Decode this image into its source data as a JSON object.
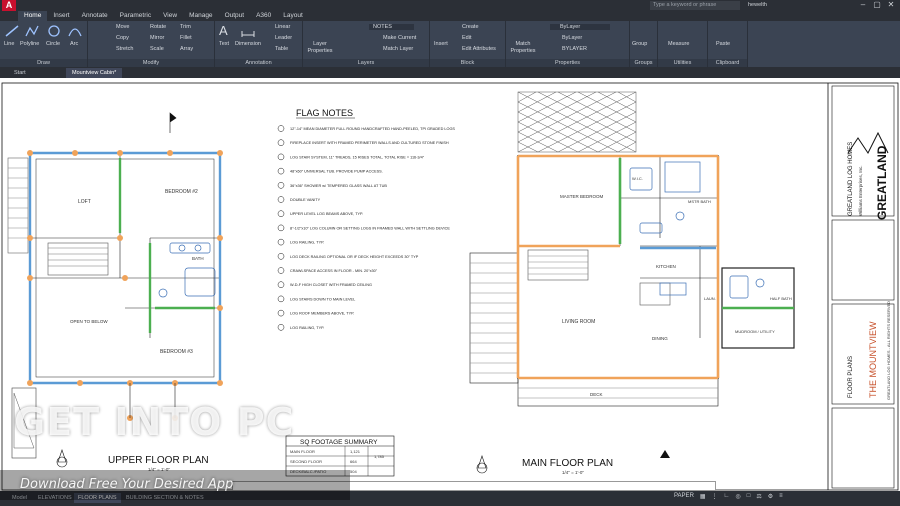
{
  "app": {
    "search_placeholder": "Type a keyword or phrase",
    "user": "hewelth"
  },
  "menu": [
    "Home",
    "Insert",
    "Annotate",
    "Parametric",
    "View",
    "Manage",
    "Output",
    "A360",
    "Layout"
  ],
  "menu_active": "Home",
  "ribbon": {
    "draw": {
      "title": "Draw",
      "tools": [
        "Line",
        "Polyline",
        "Circle",
        "Arc"
      ]
    },
    "modify": {
      "title": "Modify",
      "tools": [
        "Move",
        "Rotate",
        "Trim",
        "Copy",
        "Mirror",
        "Fillet",
        "Stretch",
        "Scale",
        "Array"
      ]
    },
    "annotation": {
      "title": "Annotation",
      "tools": [
        "Text",
        "Dimension",
        "Linear",
        "Leader",
        "Table"
      ]
    },
    "layers": {
      "title": "Layers",
      "tools": [
        "Layer Properties",
        "NOTES",
        "Make Current",
        "Match Layer"
      ]
    },
    "block": {
      "title": "Block",
      "tools": [
        "Insert",
        "Create",
        "Edit",
        "Edit Attributes"
      ]
    },
    "properties": {
      "title": "Properties",
      "tools": [
        "Match Properties",
        "ByLayer",
        "ByLayer",
        "BYLAYER"
      ]
    },
    "groups": {
      "title": "Groups",
      "tools": [
        "Group"
      ]
    },
    "utilities": {
      "title": "Utilities",
      "tools": [
        "Measure"
      ]
    },
    "clipboard": {
      "title": "Clipboard",
      "tools": [
        "Paste"
      ]
    }
  },
  "doc_tabs": [
    "Start",
    "Mountview Cabin*"
  ],
  "drawing": {
    "flag_notes_title": "FLAG NOTES",
    "flag_notes": [
      "12\"-14\" MEAN DIAMETER FULL ROUND HANDCRAFTED HAND-PEELED, TPI GRADED LOGS",
      "FIREPLACE INSERT WITH FRAMED PERIMETER WALLS AND CULTURED STONE FINISH",
      "LOG STAIR SYSTEM, 11\" TREADS, 15 RISES TOTAL, TOTAL RISE = 116-3/4\"",
      "48\"x60\" UNIVERSAL TUB. PROVIDE PUMP ACCESS.",
      "36\"x36\" SHOWER w/ TEMPERED GLASS WALL AT TUB",
      "DOUBLE VANITY",
      "UPPER LEVEL LOG BEAMS ABOVE, TYP.",
      "8\"-1/2\"x10\" LOG COLUMN OR SETTING LOGS IN FRAMED WALL WITH SETTLING DEVICE",
      "LOG RAILING, TYP.",
      "LOG DECK RAILING OPTIONAL OR IF DECK HEIGHT EXCEEDS 30\" TYP",
      "CRAWLSPACE ACCESS IN FLOOR - MIN. 20\"x30\"",
      "W-D-F HIGH CLOSET WITH FRAMED CEILING",
      "LOG STAIRS DOWN TO MAIN LEVEL",
      "LOG ROOF MEMBERS ABOVE, TYP.",
      "LOG RAILING, TYP."
    ],
    "upper_plan_title": "UPPER FLOOR PLAN",
    "upper_plan_scale": "1/4\" = 1'-0\"",
    "main_plan_title": "MAIN FLOOR PLAN",
    "main_plan_scale": "1/4\" = 1'-0\"",
    "upper_rooms": [
      "LOFT",
      "BEDROOM #2",
      "BATH",
      "OPEN TO BELOW",
      "BEDROOM #3"
    ],
    "main_rooms": [
      "MASTER BEDROOM",
      "W.I.C.",
      "MSTR BATH",
      "KITCHEN",
      "LIVING ROOM",
      "DINING",
      "LAUN.",
      "HALF BATH",
      "MUDROOM / UTILITY",
      "DECK"
    ],
    "sq_footage": {
      "title": "SQ FOOTAGE SUMMARY",
      "rows": [
        [
          "MAIN FLOOR",
          "1,121"
        ],
        [
          "SECOND FLOOR",
          "664"
        ],
        [
          "DECK/BALC./PATIO",
          "504"
        ]
      ],
      "total": "1,785"
    },
    "title_block": {
      "company": "GREATLAND LOG HOMES",
      "company_sub": "Williams Enterprises, Inc.",
      "project": "THE MOUNTVIEW",
      "sheet": "FLOOR PLANS",
      "rights": "GREATLAND LOG HOMES - ALL RIGHTS RESERVED",
      "logo": "GREATLAND"
    }
  },
  "layout_tabs": [
    "Model",
    "ELEVATIONS",
    "FLOOR PLANS",
    "BUILDING SECTION & NOTES"
  ],
  "layout_active": "FLOOR PLANS",
  "status": {
    "paper": "PAPER"
  },
  "watermark": {
    "main": "GET INTO PC",
    "sub": "Download Free Your Desired App"
  }
}
